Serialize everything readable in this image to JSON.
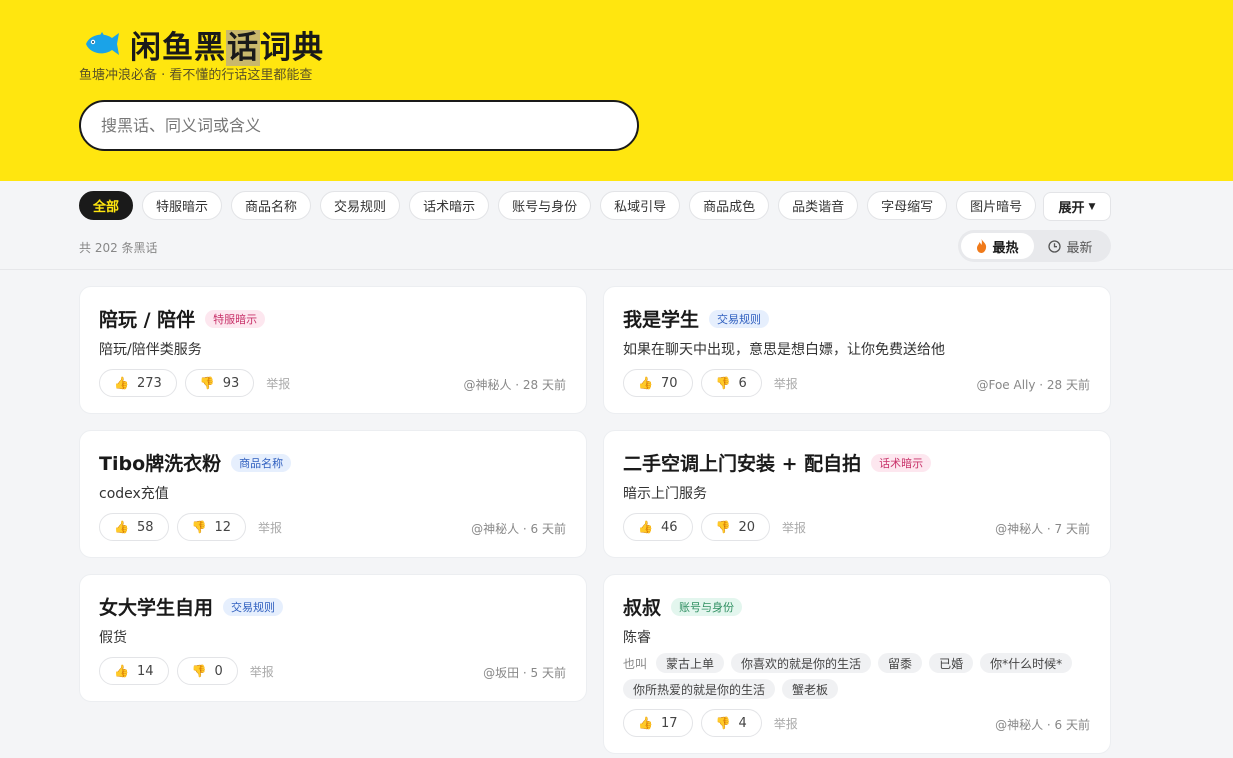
{
  "header": {
    "title_pre": "闲鱼黑",
    "title_hl": "话",
    "title_post": "词典",
    "tagline": "鱼塘冲浪必备 · 看不懂的行话这里都能查",
    "search_placeholder": "搜黑话、同义词或含义",
    "accent": "#ffe60f"
  },
  "filters": {
    "chips": [
      "全部",
      "特服暗示",
      "商品名称",
      "交易规则",
      "话术暗示",
      "账号与身份",
      "私域引导",
      "商品成色",
      "品类谐音",
      "字母缩写",
      "图片暗号"
    ],
    "active_index": 0,
    "expand_label": "展开",
    "total_text": "共 202 条黑话",
    "sort": {
      "hot": "最热",
      "new": "最新",
      "active": "hot"
    }
  },
  "cards": [
    {
      "title": "陪玩 / 陪伴",
      "tag": "特服暗示",
      "tag_color": "pink",
      "desc": "陪玩/陪伴类服务",
      "up": "273",
      "down": "93",
      "report": "举报",
      "meta": "@神秘人 · 28 天前"
    },
    {
      "title": "我是学生",
      "tag": "交易规则",
      "tag_color": "blue",
      "desc": "如果在聊天中出现，意思是想白嫖，让你免费送给他",
      "up": "70",
      "down": "6",
      "report": "举报",
      "meta": "@Foe Ally · 28 天前"
    },
    {
      "title": "Tibo牌洗衣粉",
      "tag": "商品名称",
      "tag_color": "blue",
      "desc": "codex充值",
      "up": "58",
      "down": "12",
      "report": "举报",
      "meta": "@神秘人 · 6 天前"
    },
    {
      "title": "二手空调上门安装 + 配自拍",
      "tag": "话术暗示",
      "tag_color": "pink",
      "desc": "暗示上门服务",
      "up": "46",
      "down": "20",
      "report": "举报",
      "meta": "@神秘人 · 7 天前"
    },
    {
      "title": "女大学生自用",
      "tag": "交易规则",
      "tag_color": "blue",
      "desc": "假货",
      "up": "14",
      "down": "0",
      "report": "举报",
      "meta": "@坂田 · 5 天前"
    },
    {
      "title": "叔叔",
      "tag": "账号与身份",
      "tag_color": "green",
      "desc": "陈睿",
      "alias_label": "也叫",
      "aliases": [
        "蒙古上单",
        "你喜欢的就是你的生活",
        "留黍",
        "已婚",
        "你*什么时候*",
        "你所热爱的就是你的生活",
        "蟹老板"
      ],
      "up": "17",
      "down": "4",
      "report": "举报",
      "meta": "@神秘人 · 6 天前"
    }
  ]
}
